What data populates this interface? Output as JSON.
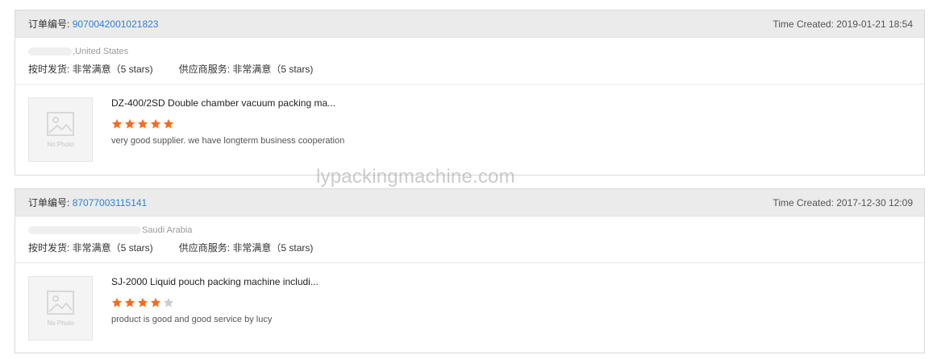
{
  "colors": {
    "accent_link": "#2f7fd4",
    "star_filled": "#f26d21",
    "star_empty": "#cccccc",
    "header_bg": "#ebebeb"
  },
  "orders": [
    {
      "order_label": "订单编号:",
      "order_no": "9070042001021823",
      "time_created": "Time Created: 2019-01-21 18:54",
      "buyer_country": ",United States",
      "on_time_delivery": "按时发货: 非常满意（5 stars)",
      "supplier_service": "供应商服务: 非常满意（5 stars)",
      "photo_placeholder": "No Photo",
      "product_title": "DZ-400/2SD Double chamber vacuum packing ma...",
      "rating": 5,
      "review": "very good supplier. we have longterm business cooperation"
    },
    {
      "order_label": "订单编号:",
      "order_no": "87077003115141",
      "time_created": "Time Created: 2017-12-30 12:09",
      "buyer_country": "Saudi Arabia",
      "on_time_delivery": "按时发货: 非常满意（5 stars)",
      "supplier_service": "供应商服务: 非常满意（5 stars)",
      "photo_placeholder": "No Photo",
      "product_title": "SJ-2000 Liquid pouch packing machine includi...",
      "rating": 4,
      "review": "product is good and good service by lucy"
    }
  ],
  "watermark": "lypackingmachine.com"
}
